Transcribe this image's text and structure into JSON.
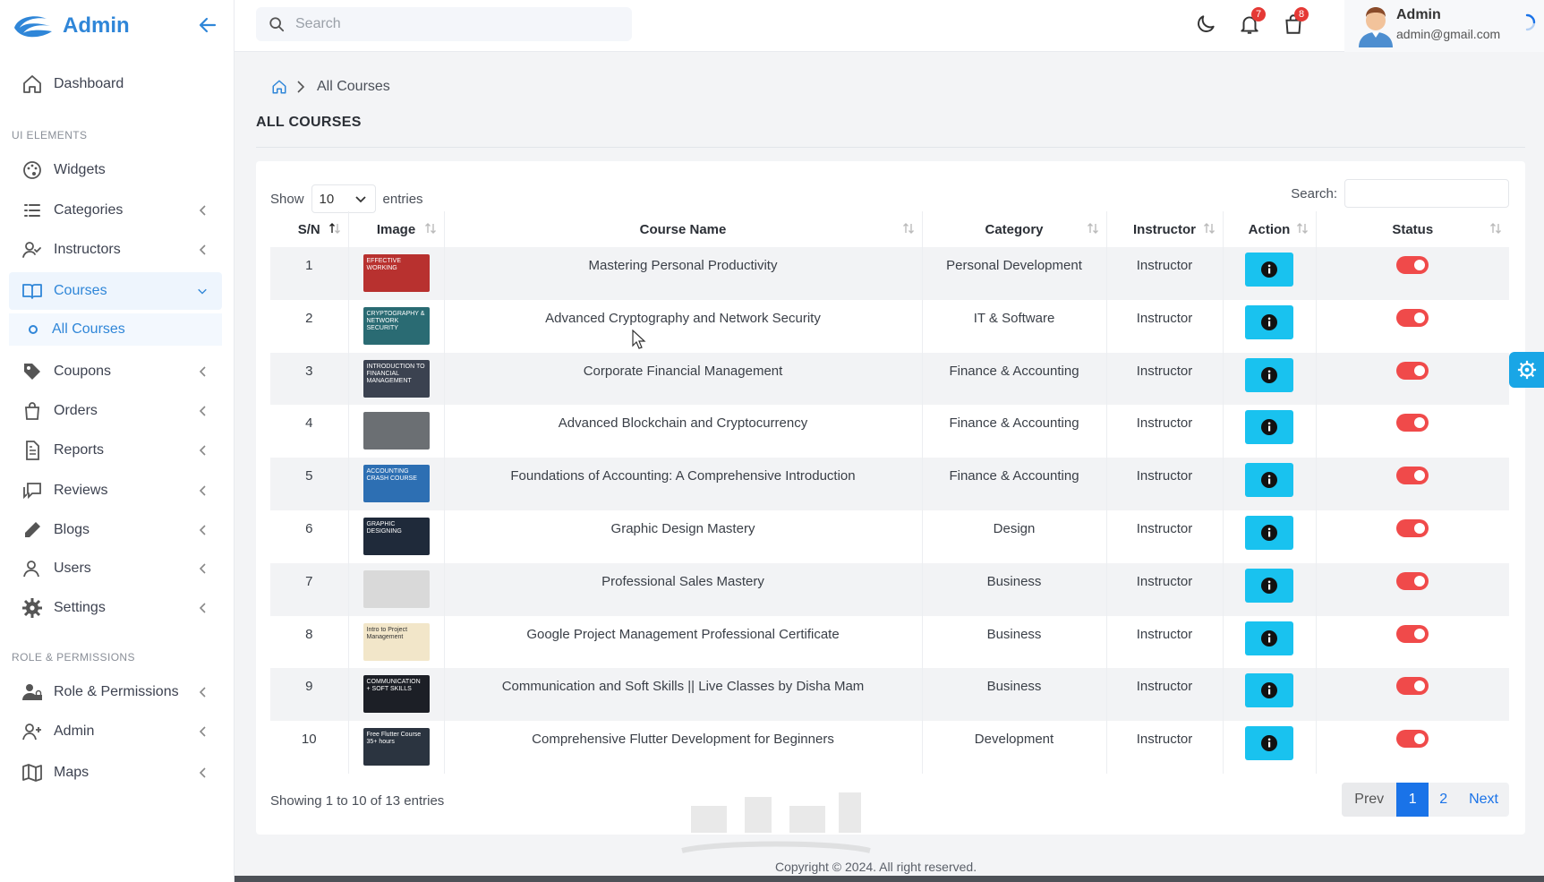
{
  "brand": {
    "name": "Admin"
  },
  "sidebar": {
    "dashboard": "Dashboard",
    "section_ui": "UI ELEMENTS",
    "widgets": "Widgets",
    "categories": "Categories",
    "instructors": "Instructors",
    "courses": "Courses",
    "all_courses": "All Courses",
    "coupons": "Coupons",
    "orders": "Orders",
    "reports": "Reports",
    "reviews": "Reviews",
    "blogs": "Blogs",
    "users": "Users",
    "settings": "Settings",
    "section_role": "ROLE & PERMISSIONS",
    "role_permissions": "Role & Permissions",
    "admin": "Admin",
    "maps": "Maps"
  },
  "header": {
    "search_placeholder": "Search",
    "notifications_count": "7",
    "cart_count": "8",
    "user_name": "Admin",
    "user_email": "admin@gmail.com"
  },
  "breadcrumb": {
    "current": "All Courses"
  },
  "page": {
    "title": "ALL COURSES"
  },
  "table_controls": {
    "show_label": "Show",
    "entries_value": "10",
    "entries_label": "entries",
    "search_label": "Search:"
  },
  "table": {
    "columns": [
      "S/N",
      "Image",
      "Course Name",
      "Category",
      "Instructor",
      "Action",
      "Status"
    ],
    "rows": [
      {
        "sn": "1",
        "name": "Mastering Personal Productivity",
        "category": "Personal Development",
        "instructor": "Instructor",
        "thumb_color": "#b8312f"
      },
      {
        "sn": "2",
        "name": "Advanced Cryptography and Network Security",
        "category": "IT & Software",
        "instructor": "Instructor",
        "thumb_color": "#2a6b73"
      },
      {
        "sn": "3",
        "name": "Corporate Financial Management",
        "category": "Finance & Accounting",
        "instructor": "Instructor",
        "thumb_color": "#3b4250"
      },
      {
        "sn": "4",
        "name": "Advanced Blockchain and Cryptocurrency",
        "category": "Finance & Accounting",
        "instructor": "Instructor",
        "thumb_color": "#6b6f73"
      },
      {
        "sn": "5",
        "name": "Foundations of Accounting: A Comprehensive Introduction",
        "category": "Finance & Accounting",
        "instructor": "Instructor",
        "thumb_color": "#2d6fb3"
      },
      {
        "sn": "6",
        "name": "Graphic Design Mastery",
        "category": "Design",
        "instructor": "Instructor",
        "thumb_color": "#1f2a3a"
      },
      {
        "sn": "7",
        "name": "Professional Sales Mastery",
        "category": "Business",
        "instructor": "Instructor",
        "thumb_color": "#d9d9d9"
      },
      {
        "sn": "8",
        "name": "Google Project Management Professional Certificate",
        "category": "Business",
        "instructor": "Instructor",
        "thumb_color": "#f2e6c9"
      },
      {
        "sn": "9",
        "name": "Communication and Soft Skills || Live Classes by Disha Mam",
        "category": "Business",
        "instructor": "Instructor",
        "thumb_color": "#1c1f26"
      },
      {
        "sn": "10",
        "name": "Comprehensive Flutter Development for Beginners",
        "category": "Development",
        "instructor": "Instructor",
        "thumb_color": "#2b3440"
      }
    ]
  },
  "thumbs": {
    "row1": "EFFECTIVE WORKING",
    "row2": "CRYPTOGRAPHY & NETWORK SECURITY",
    "row3": "INTRODUCTION TO FINANCIAL MANAGEMENT",
    "row5": "ACCOUNTING CRASH COURSE",
    "row6": "GRAPHIC DESIGNING",
    "row8": "Intro to Project Management",
    "row9": "COMMUNICATION + SOFT SKILLS",
    "row10": "Free Flutter Course 35+ hours"
  },
  "footer_info": "Showing 1 to 10 of 13 entries",
  "pagination": {
    "prev": "Prev",
    "page1": "1",
    "page2": "2",
    "next": "Next"
  },
  "copyright": "Copyright © 2024. All right reserved.",
  "colors": {
    "primary": "#2f86d8",
    "action": "#19c2ef",
    "toggle": "#f04a4a",
    "page_active": "#1a73e8"
  }
}
